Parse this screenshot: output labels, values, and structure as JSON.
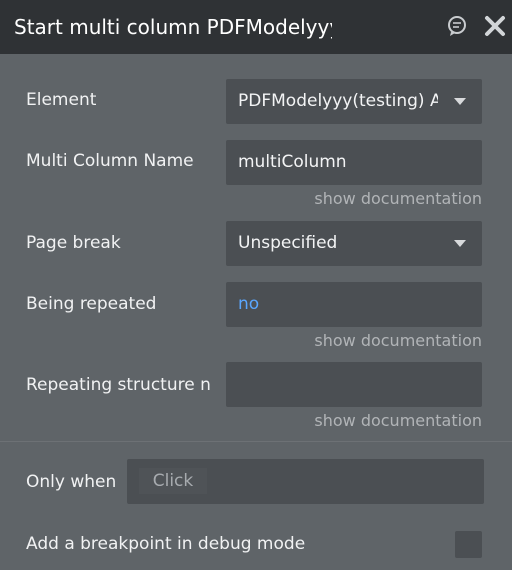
{
  "header": {
    "title": "Start multi column PDFModelyyy",
    "icons": [
      "comment-icon",
      "close-icon"
    ]
  },
  "form": {
    "element": {
      "label": "Element",
      "value": "PDFModelyyy(testing) A"
    },
    "multi_column_name": {
      "label": "Multi Column Name",
      "value": "multiColumn",
      "doc_link": "show documentation"
    },
    "page_break": {
      "label": "Page break",
      "value": "Unspecified"
    },
    "being_repeated": {
      "label": "Being repeated",
      "value": "no",
      "value_color": "#5aa7ff",
      "doc_link": "show documentation"
    },
    "repeating_structure": {
      "label": "Repeating structure n",
      "value": "",
      "doc_link": "show documentation"
    },
    "only_when": {
      "label": "Only when",
      "placeholder": "Click"
    },
    "breakpoint": {
      "label": "Add a breakpoint in debug mode",
      "checked": false
    }
  }
}
